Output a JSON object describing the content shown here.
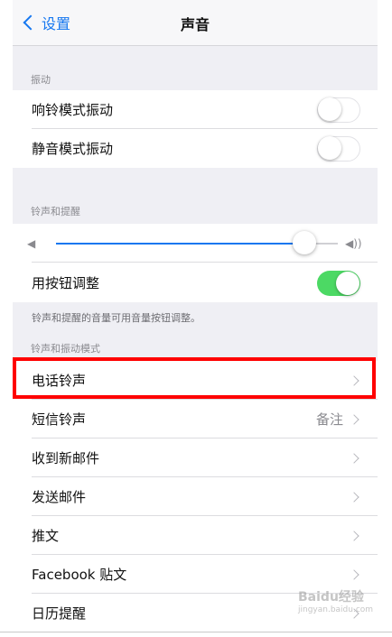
{
  "nav": {
    "back_label": "设置",
    "title": "声音"
  },
  "vibration": {
    "header": "振动",
    "items": [
      {
        "label": "响铃模式振动",
        "toggle": "off"
      },
      {
        "label": "静音模式振动",
        "toggle": "off"
      }
    ]
  },
  "ringer": {
    "header": "铃声和提醒",
    "volume_level": 0.88,
    "button_adjust_label": "用按钮调整",
    "button_adjust_toggle": "on",
    "footnote": "铃声和提醒的音量可用音量按钮调整。"
  },
  "patterns": {
    "header": "铃声和振动模式",
    "items": [
      {
        "label": "电话铃声",
        "detail": ""
      },
      {
        "label": "短信铃声",
        "detail": "备注"
      },
      {
        "label": "收到新邮件",
        "detail": ""
      },
      {
        "label": "发送邮件",
        "detail": ""
      },
      {
        "label": "推文",
        "detail": ""
      },
      {
        "label": "Facebook 贴文",
        "detail": ""
      },
      {
        "label": "日历提醒",
        "detail": ""
      }
    ]
  },
  "watermark": {
    "text": "Baidu经验",
    "sub": "jingyan.baidu.com"
  },
  "colors": {
    "accent": "#1577f0",
    "toggle_on": "#4cd964",
    "highlight": "#ff0000"
  }
}
